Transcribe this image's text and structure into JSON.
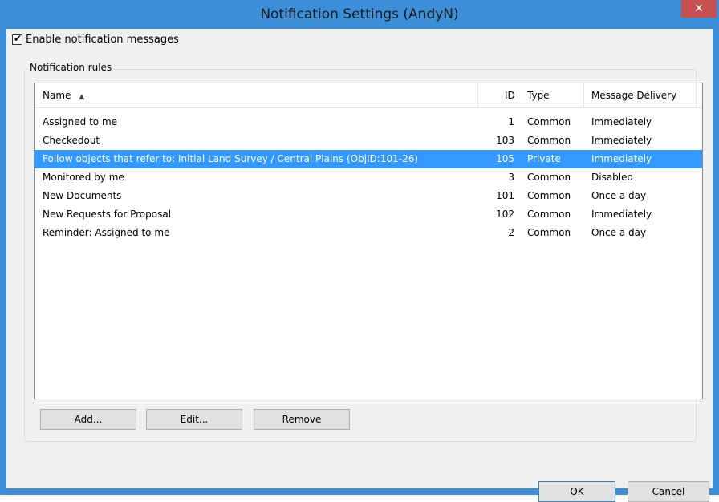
{
  "window": {
    "title": "Notification Settings (AndyN)",
    "close_glyph": "✕"
  },
  "enable_checkbox": {
    "label": "Enable notification messages",
    "checked": true,
    "check_glyph": "✔"
  },
  "group": {
    "label": "Notification rules"
  },
  "columns": {
    "name": "Name",
    "sort_glyph": "▲",
    "id": "ID",
    "type": "Type",
    "delivery": "Message Delivery"
  },
  "rules": [
    {
      "name": "Assigned to me",
      "id": "1",
      "type": "Common",
      "delivery": "Immediately",
      "selected": false
    },
    {
      "name": "Checkedout",
      "id": "103",
      "type": "Common",
      "delivery": "Immediately",
      "selected": false
    },
    {
      "name": "Follow objects that refer to: Initial Land Survey / Central Plains (ObjID:101-26)",
      "id": "105",
      "type": "Private",
      "delivery": "Immediately",
      "selected": true
    },
    {
      "name": "Monitored by me",
      "id": "3",
      "type": "Common",
      "delivery": "Disabled",
      "selected": false
    },
    {
      "name": "New Documents",
      "id": "101",
      "type": "Common",
      "delivery": "Once a day",
      "selected": false
    },
    {
      "name": "New Requests for Proposal",
      "id": "102",
      "type": "Common",
      "delivery": "Immediately",
      "selected": false
    },
    {
      "name": "Reminder: Assigned to me",
      "id": "2",
      "type": "Common",
      "delivery": "Once a day",
      "selected": false
    }
  ],
  "buttons": {
    "add": "Add...",
    "edit": "Edit...",
    "remove": "Remove",
    "ok": "OK",
    "cancel": "Cancel"
  },
  "colors": {
    "titlebar": "#3b8fd9",
    "close": "#c75050",
    "selection": "#3399ff",
    "dialog_bg": "#f0f0f0"
  }
}
